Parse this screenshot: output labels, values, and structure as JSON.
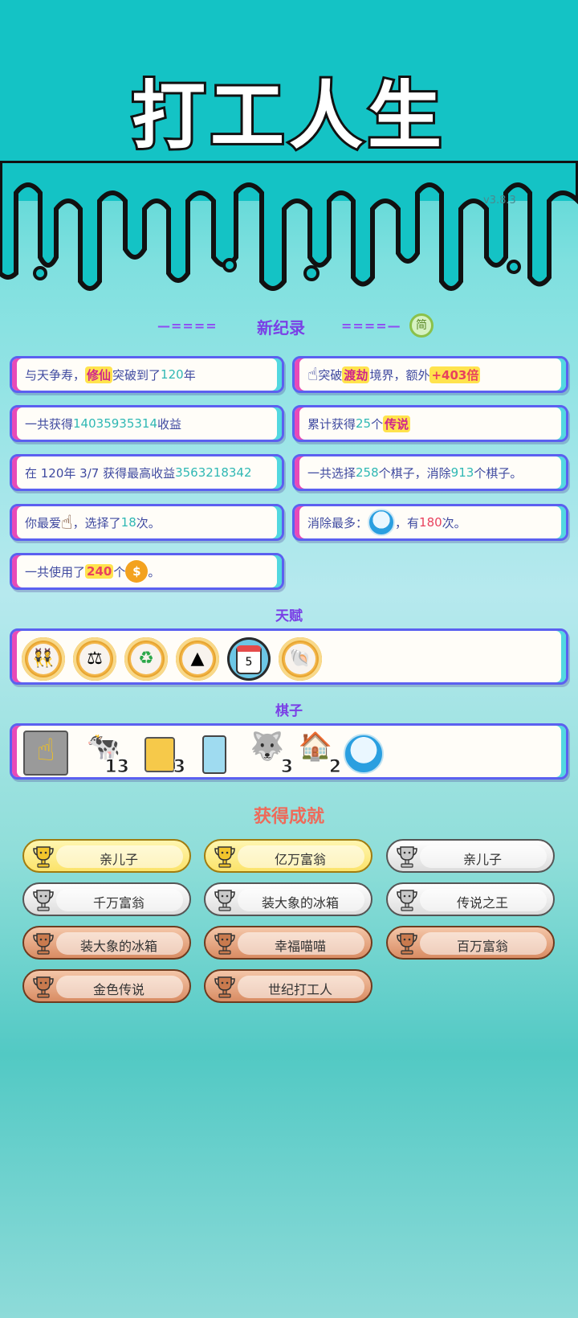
{
  "title": "打工人生",
  "version": "v3.8.3",
  "records": {
    "heading": "新纪录",
    "dashes_left": "—====",
    "dashes_right": "====—",
    "badge": "简",
    "cards": [
      {
        "p1": "与天争寿，",
        "hl": "修仙",
        "p2": "突破到了",
        "n": "120",
        "p3": "年"
      },
      {
        "p1": "突破",
        "hl": "渡劫",
        "p2": "境界，额外",
        "n": "+403倍",
        "p3": ""
      },
      {
        "p1": "一共获得",
        "n": "14035935314",
        "p2": "收益"
      },
      {
        "p1": "累计获得",
        "n": "25",
        "p2": "个",
        "hl": "传说"
      },
      {
        "p1": "在 120年 3/7 获得最高收益",
        "n": "3563218342"
      },
      {
        "p1": "一共选择",
        "n": "258",
        "p2": "个棋子，消除",
        "n2": "913",
        "p3": "个棋子。"
      },
      {
        "p1": "你最爱",
        "p2": "，选择了",
        "n": "18",
        "p3": "次。"
      },
      {
        "p1": "消除最多：",
        "p2": "，有",
        "n": "180",
        "p3": "次。"
      },
      {
        "p1": "一共使用了",
        "n": "240",
        "p2": "个",
        "p3": "。"
      }
    ]
  },
  "talents": {
    "heading": "天赋",
    "items": [
      "twins-icon",
      "balance-icon",
      "recycle-icon",
      "skirt-icon",
      "calendar-icon",
      "shell-icon"
    ],
    "calendar_num": "5"
  },
  "pieces": {
    "heading": "棋子",
    "items": [
      {
        "icon": "hand-pointer-icon",
        "count": ""
      },
      {
        "icon": "cow-icon",
        "count": "13"
      },
      {
        "icon": "claw-machine-icon",
        "count": "3"
      },
      {
        "icon": "fridge-icon",
        "count": ""
      },
      {
        "icon": "husky-king-icon",
        "count": "3"
      },
      {
        "icon": "house-icon",
        "count": "2"
      },
      {
        "icon": "globe-island-icon",
        "count": ""
      }
    ]
  },
  "achievements": {
    "heading": "获得成就",
    "items": [
      {
        "label": "亲儿子",
        "tier": "gold"
      },
      {
        "label": "亿万富翁",
        "tier": "gold"
      },
      {
        "label": "亲儿子",
        "tier": "silver"
      },
      {
        "label": "千万富翁",
        "tier": "silver"
      },
      {
        "label": "装大象的冰箱",
        "tier": "silver"
      },
      {
        "label": "传说之王",
        "tier": "silver"
      },
      {
        "label": "装大象的冰箱",
        "tier": "bronze"
      },
      {
        "label": "幸福喵喵",
        "tier": "bronze"
      },
      {
        "label": "百万富翁",
        "tier": "bronze"
      },
      {
        "label": "金色传说",
        "tier": "bronze"
      },
      {
        "label": "世纪打工人",
        "tier": "bronze"
      }
    ]
  },
  "colors": {
    "accent": "#7a3fe6",
    "card_border": "#5b60f0",
    "highlight": "#ffe34d"
  }
}
